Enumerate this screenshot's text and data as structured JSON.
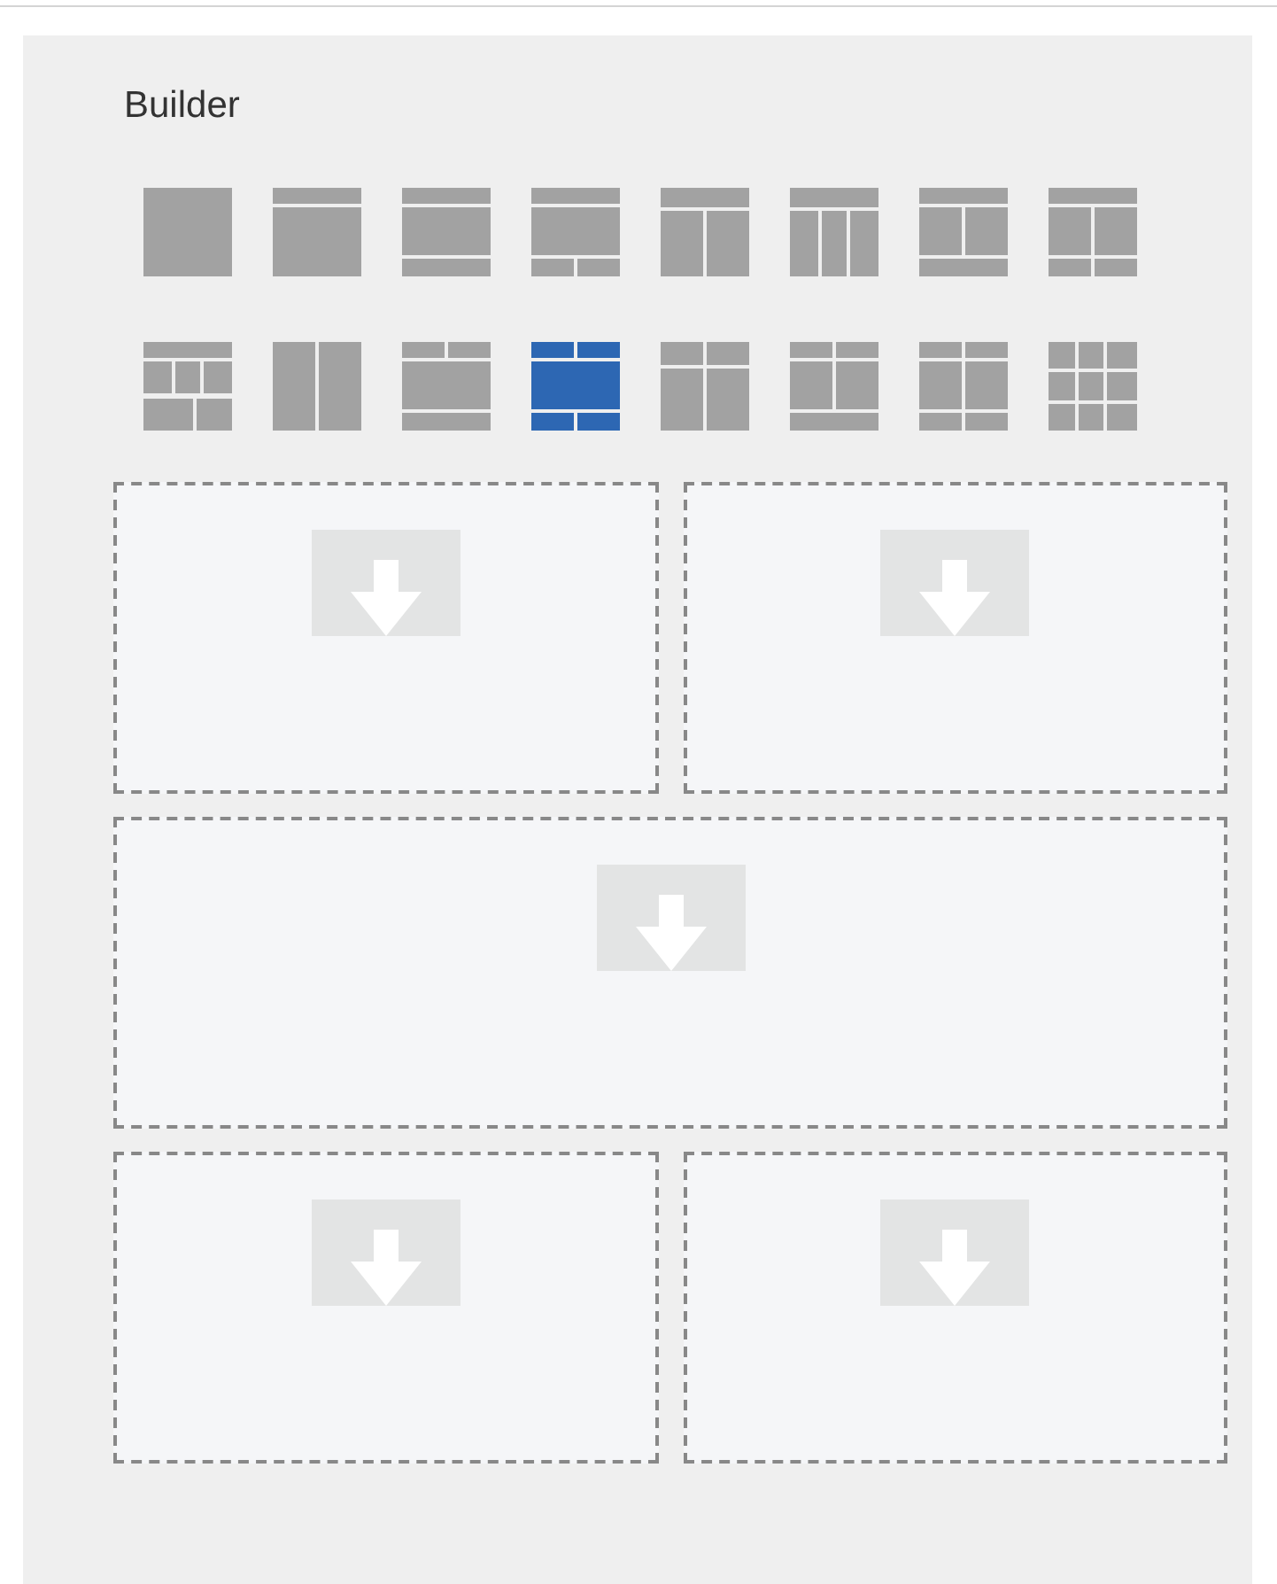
{
  "panel": {
    "title": "Builder"
  },
  "layouts": [
    [
      {
        "kind": "full",
        "selected": false
      },
      {
        "kind": "hb",
        "selected": false
      },
      {
        "kind": "hbf",
        "selected": false
      },
      {
        "kind": "hbff",
        "selected": false
      },
      {
        "kind": "h2c",
        "selected": false
      },
      {
        "kind": "h3c",
        "selected": false
      },
      {
        "kind": "h2cf",
        "selected": false
      },
      {
        "kind": "h2cff",
        "selected": false
      }
    ],
    [
      {
        "kind": "h3cff",
        "selected": false
      },
      {
        "kind": "c2",
        "selected": false
      },
      {
        "kind": "hhbf",
        "selected": false
      },
      {
        "kind": "hhbff",
        "selected": true
      },
      {
        "kind": "hh2c",
        "selected": false
      },
      {
        "kind": "hh2cf",
        "selected": false
      },
      {
        "kind": "hh2cff",
        "selected": false
      },
      {
        "kind": "grid",
        "selected": false
      }
    ]
  ],
  "drop_rows": [
    {
      "zones": [
        {
          "kind": "drop-target"
        },
        {
          "kind": "drop-target"
        }
      ]
    },
    {
      "zones": [
        {
          "kind": "drop-target"
        }
      ]
    },
    {
      "zones": [
        {
          "kind": "drop-target"
        },
        {
          "kind": "drop-target"
        }
      ]
    }
  ]
}
